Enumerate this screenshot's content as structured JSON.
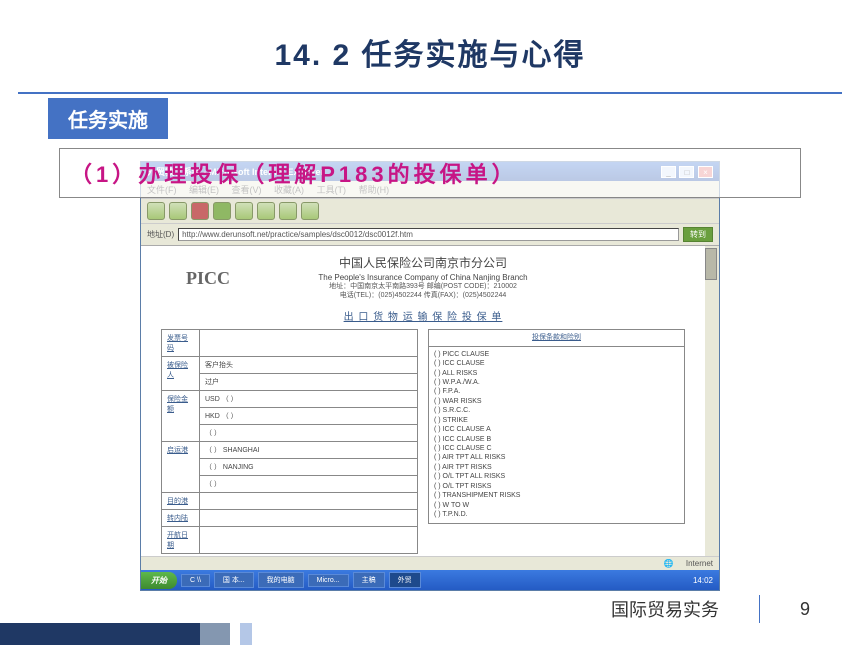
{
  "slide": {
    "title": "14. 2 任务实施与心得",
    "section_label": "任务实施",
    "task_item": "（1）办理投保（理解P183的投保单）",
    "footer_text": "国际贸易实务",
    "page_number": "9"
  },
  "browser": {
    "window_title": "外贸教学系统 - Microsoft Internet Explorer",
    "menu": {
      "file": "文件(F)",
      "edit": "编辑(E)",
      "view": "查看(V)",
      "fav": "收藏(A)",
      "tools": "工具(T)",
      "help": "帮助(H)"
    },
    "address_label": "地址(D)",
    "url": "http://www.derunsoft.net/practice/samples/dsc0012/dsc0012f.htm",
    "go_button": "转到",
    "status_internet": "Internet"
  },
  "taskbar": {
    "start": "开始",
    "items": [
      "C \\\\",
      "国 本...",
      "我的电脑",
      "Micro...",
      "主稿",
      "外贸"
    ],
    "time": "14:02"
  },
  "document": {
    "company_cn": "中国人民保险公司南京市分公司",
    "company_en": "The People's Insurance Company of China Nanjing Branch",
    "address": "地址：中国南京太平南路393号   邮编(POST CODE)：210002",
    "contact": "电话(TEL)：(025)4502244        传真(FAX)：(025)4502244",
    "logo": "PICC",
    "form_title": "出 口 货 物 运 输 保 险 投 保 单",
    "left_fields": {
      "invoice": "发票号码",
      "insured": "被保险人",
      "insured_sub1": "客户抬头",
      "insured_sub2": "过户",
      "amount": "保险金额",
      "amount_rows": [
        "USD     （          ）",
        "HKD     （          ）",
        "          （          ）"
      ],
      "port": "启运港",
      "port_rows": [
        "（    ）   SHANGHAI",
        "（    ）   NANJING",
        "（    ）"
      ],
      "dest": "目的港",
      "inland": "转内陆",
      "sail": "开航日期"
    },
    "right_header": "投保条款和险别",
    "risks": [
      "(  ) PICC CLAUSE",
      "(  ) ICC CLAUSE",
      "(  ) ALL RISKS",
      "(  ) W.P.A./W.A.",
      "(  ) F.P.A.",
      "(  ) WAR RISKS",
      "(  ) S.R.C.C.",
      "(  ) STRIKE",
      "(  ) ICC CLAUSE A",
      "(  ) ICC CLAUSE B",
      "(  ) ICC CLAUSE C",
      "(  ) AIR TPT ALL RISKS",
      "(  ) AIR TPT RISKS",
      "(  ) O/L TPT ALL RISKS",
      "(  ) O/L TPT RISKS",
      "(  ) TRANSHIPMENT RISKS",
      "(  ) W TO W",
      "(  ) T.P.N.D."
    ]
  }
}
